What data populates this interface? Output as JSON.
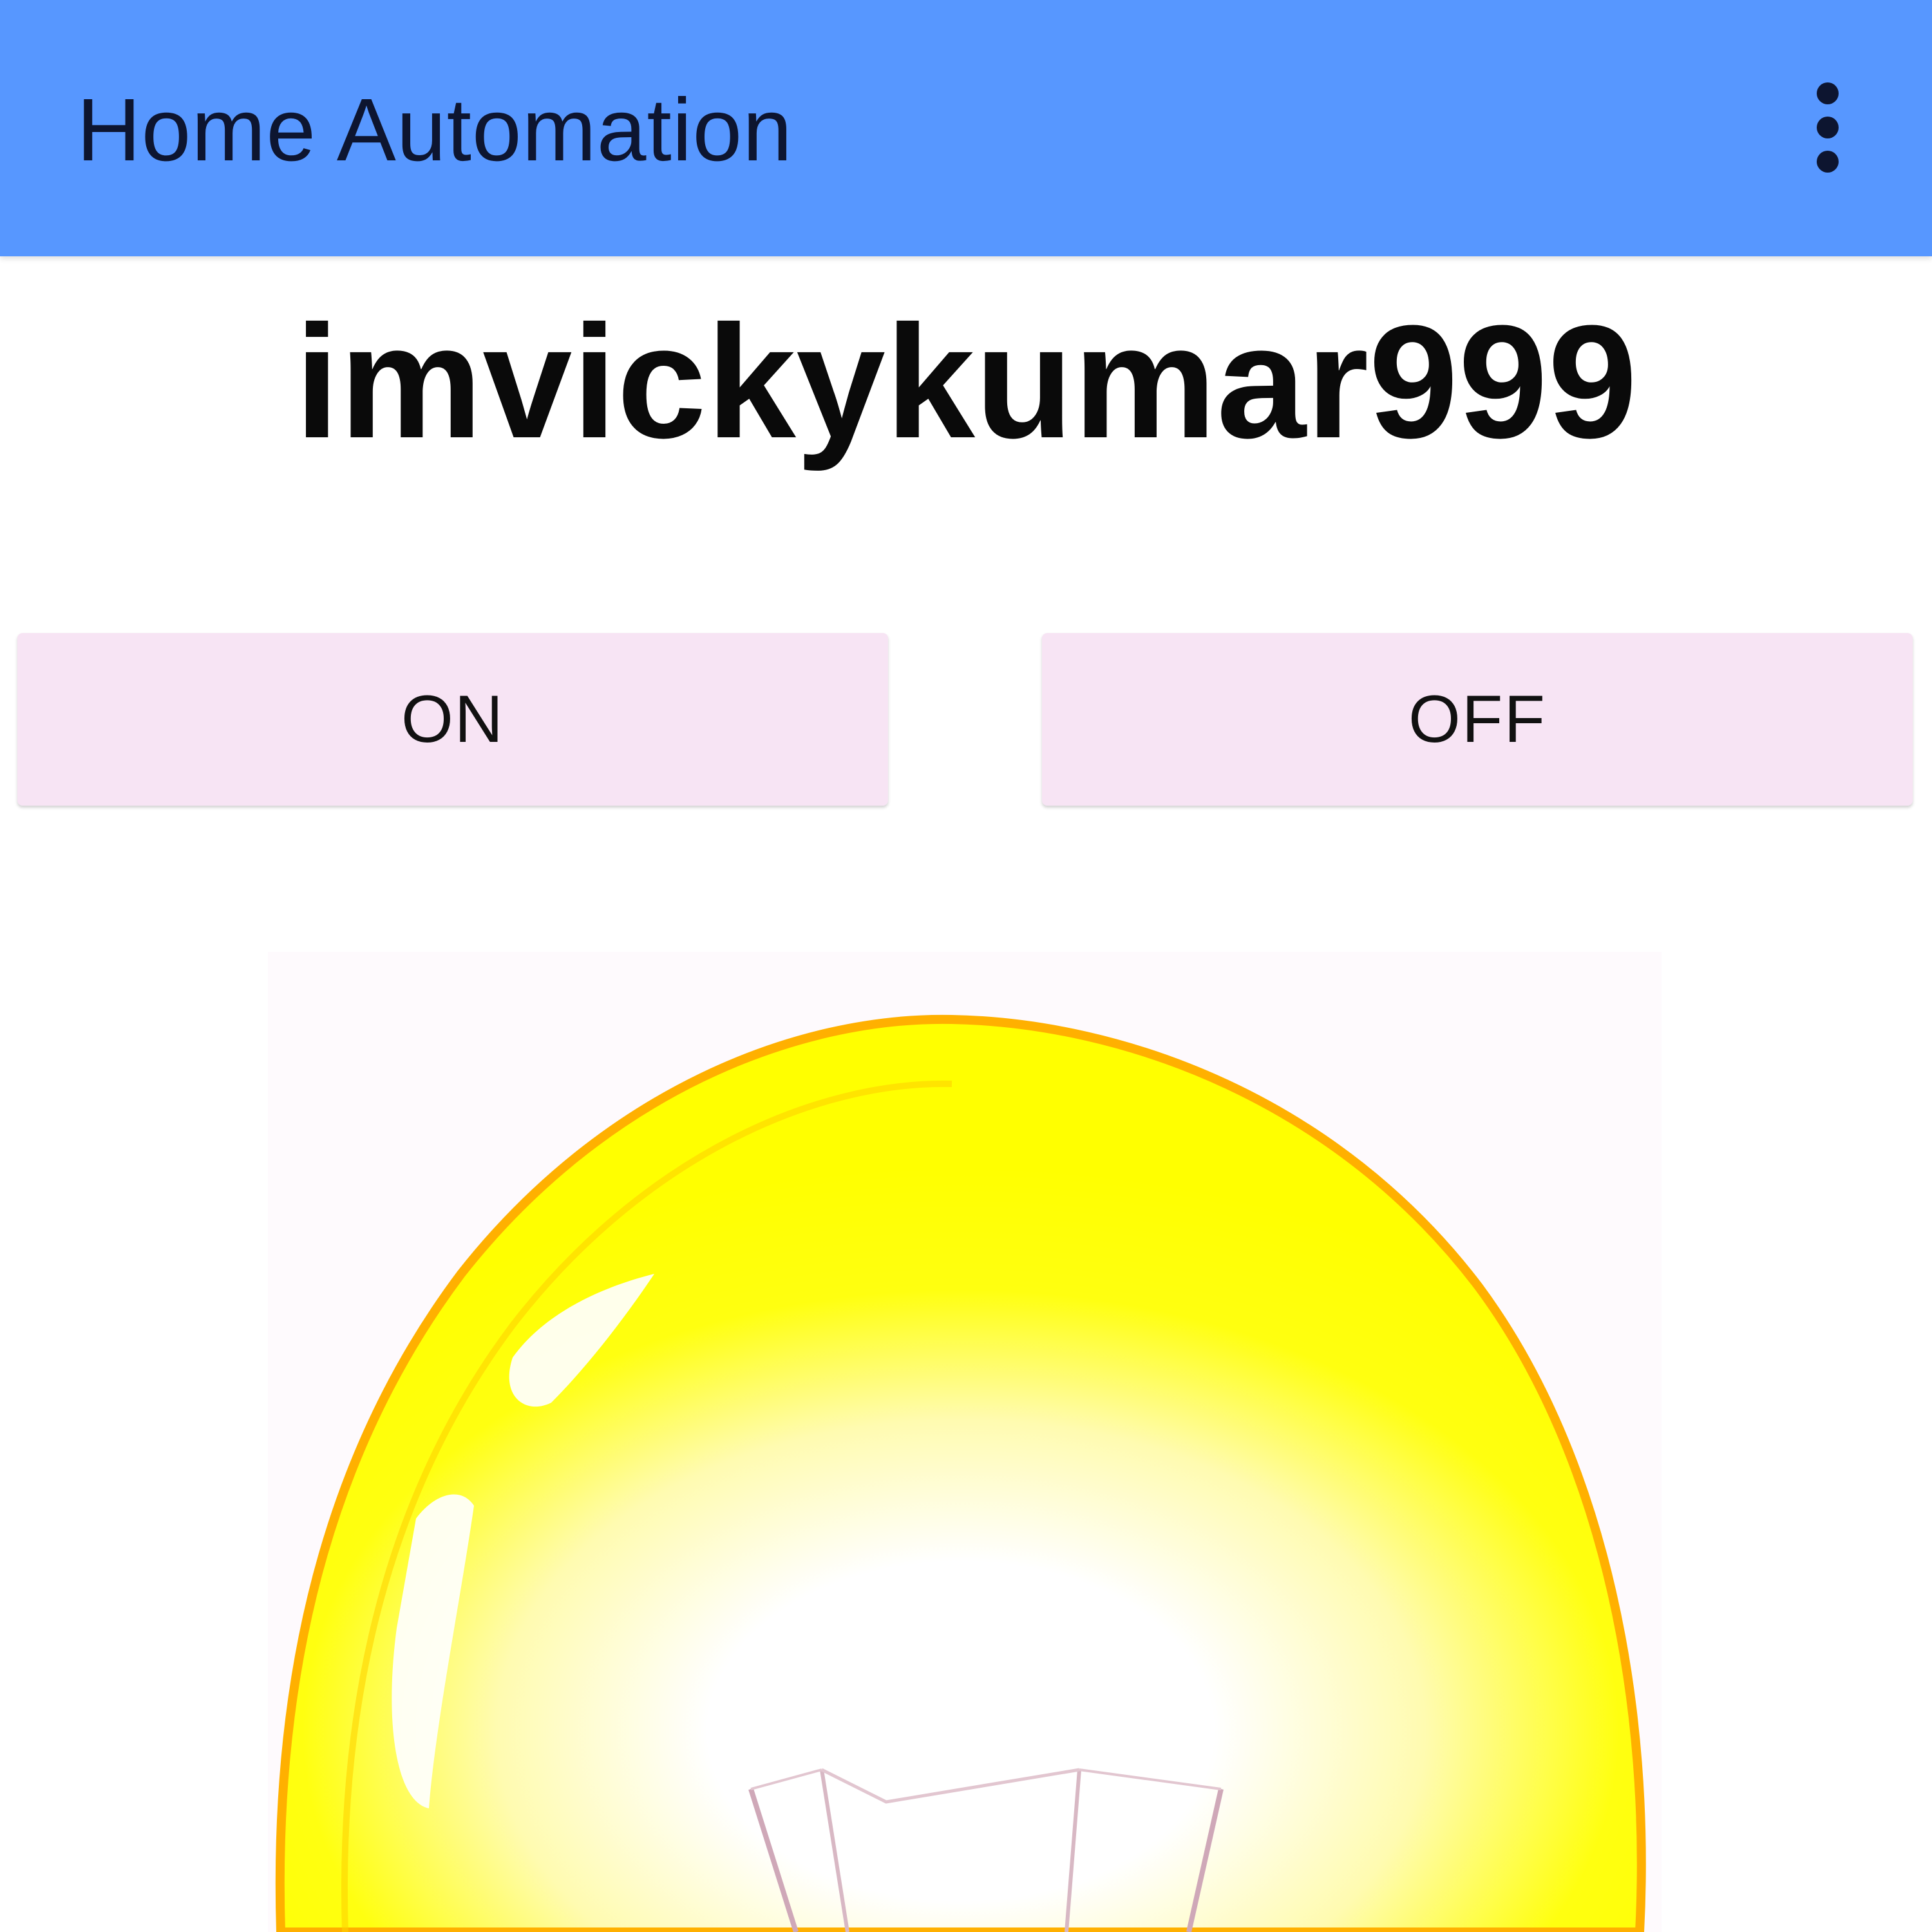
{
  "app_bar": {
    "title": "Home Automation",
    "menu_icon": "more-vert-icon",
    "background_color": "#5797ff"
  },
  "main": {
    "username": "imvickykumar999",
    "buttons": {
      "on_label": "ON",
      "off_label": "OFF",
      "background_color": "#f7e4f4"
    },
    "bulb": {
      "icon": "lightbulb-on-icon",
      "glass_color": "#ffff00",
      "outline_color": "#ffb000"
    }
  }
}
